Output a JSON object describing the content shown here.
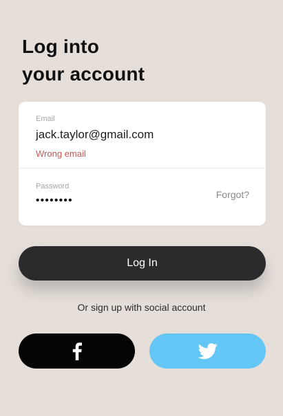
{
  "header": {
    "title_line1": "Log into",
    "title_line2": "your account"
  },
  "form": {
    "email": {
      "label": "Email",
      "value": "jack.taylor@gmail.com",
      "error": "Wrong email"
    },
    "password": {
      "label": "Password",
      "value": "••••••••",
      "forgot_label": "Forgot?"
    }
  },
  "actions": {
    "login_label": "Log In",
    "social_prompt": "Or sign up with social account"
  },
  "social": {
    "facebook": {
      "icon": "facebook-icon",
      "color": "#050505"
    },
    "twitter": {
      "icon": "twitter-icon",
      "color": "#63c6f5"
    }
  },
  "colors": {
    "background": "#e5ded9",
    "card": "#ffffff",
    "error": "#c25a55",
    "primary_button": "#2b2b2e"
  }
}
